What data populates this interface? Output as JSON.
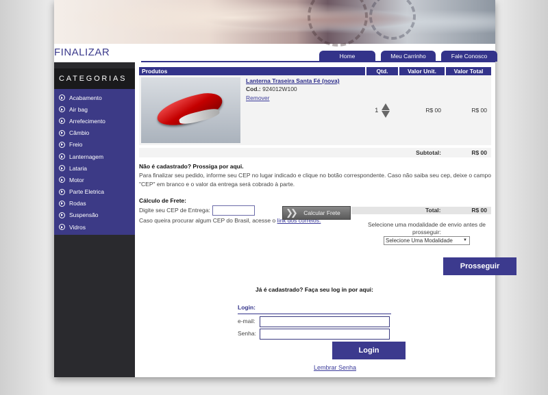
{
  "page": {
    "title": "FINALIZAR"
  },
  "topnav": [
    {
      "label": "Home"
    },
    {
      "label": "Meu Carrinho"
    },
    {
      "label": "Fale Conosco"
    }
  ],
  "sidebar": {
    "heading": "CATEGORIAS",
    "items": [
      {
        "label": "Acabamento"
      },
      {
        "label": "Air bag"
      },
      {
        "label": "Arrefecimento"
      },
      {
        "label": "Câmbio"
      },
      {
        "label": "Freio"
      },
      {
        "label": "Lanternagem"
      },
      {
        "label": "Lataria"
      },
      {
        "label": "Motor"
      },
      {
        "label": "Parte Eletrica"
      },
      {
        "label": "Rodas"
      },
      {
        "label": "Suspensão"
      },
      {
        "label": "Vidros"
      }
    ]
  },
  "cart": {
    "columns": {
      "produtos": "Produtos",
      "qtd": "Qtd.",
      "unit": "Valor Unit.",
      "total": "Valor Total"
    },
    "item": {
      "name": "Lanterna Traseira Santa Fé (nova)",
      "cod_label": "Cod.:",
      "cod_value": "924012W100",
      "remove_label": "Remover",
      "qty": "1",
      "unit_price": "R$ 00",
      "total_price": "R$ 00"
    },
    "subtotal_label": "Subtotal:",
    "subtotal_value": "R$ 00"
  },
  "not_registered": {
    "heading": "Não é cadastrado? Prossiga por aqui.",
    "text": "Para finalizar seu pedido, informe seu CEP no lugar indicado e clique no botão correspondente. Caso não saiba seu cep, deixe o campo \"CEP\" em branco e o valor da entrega será cobrado à parte."
  },
  "freight": {
    "heading": "Cálculo de Frete:",
    "cep_label": "Digite seu CEP de Entrega:",
    "cep_value": "",
    "calc_button": "Calcular Frete",
    "help_text": "Caso queira procurar algum CEP do Brasil, acesse o",
    "help_link": "link dos correios."
  },
  "totals": {
    "label": "Total:",
    "value": "R$ 00"
  },
  "shipping": {
    "prompt": "Selecione uma modalidade de envio antes de prosseguir:",
    "selected": "Selecione Uma Modalidade",
    "continue_button": "Prosseguir"
  },
  "login": {
    "prompt": "Já é cadastrado? Faça seu log in por aqui:",
    "heading": "Login:",
    "email_label": "e-mail:",
    "email_value": "",
    "password_label": "Senha:",
    "password_value": "",
    "button": "Login",
    "forgot_link": "Lembrar Senha"
  }
}
